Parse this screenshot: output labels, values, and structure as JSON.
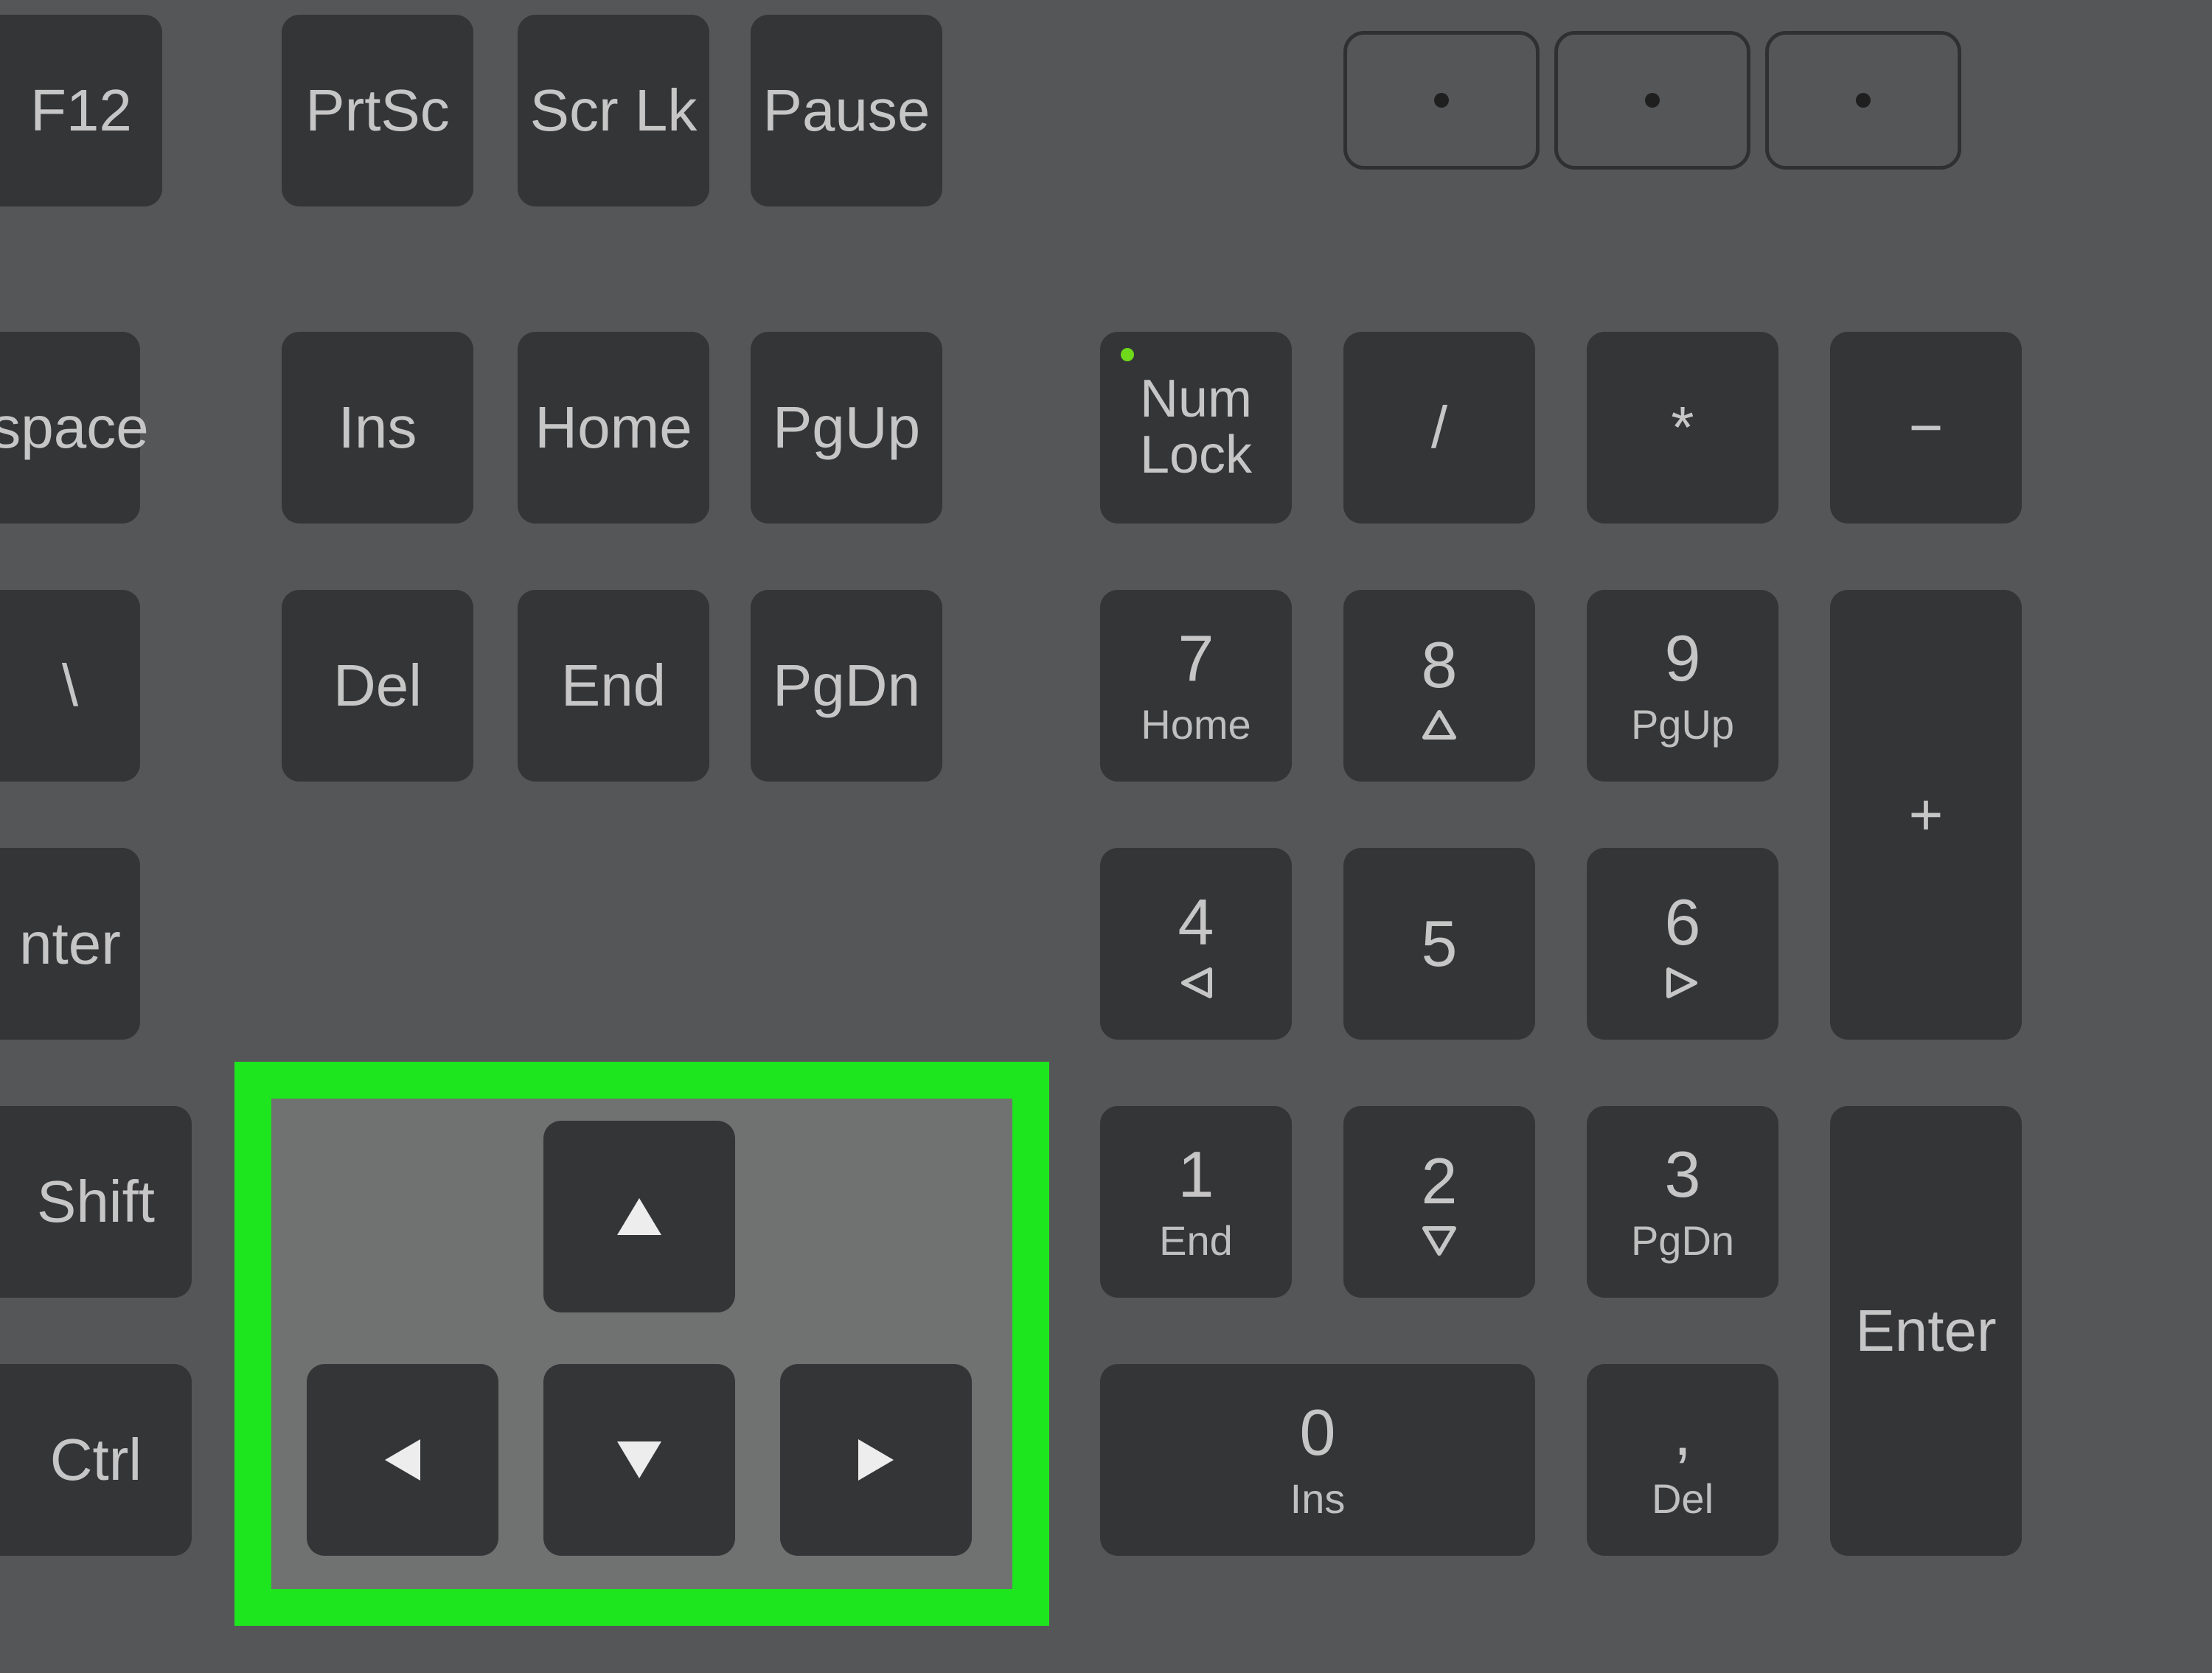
{
  "keys": {
    "f12": "F12",
    "prtsc": "PrtSc",
    "scrlk": "Scr Lk",
    "pause": "Pause",
    "space": "space",
    "ins": "Ins",
    "home": "Home",
    "pgup": "PgUp",
    "backslash": "\\",
    "del": "Del",
    "end": "End",
    "pgdn": "PgDn",
    "enter_side": "nter",
    "shift_side": "Shift",
    "ctrl_side": "Ctrl",
    "numlock_l1": "Num",
    "numlock_l2": "Lock",
    "div": "/",
    "mul": "*",
    "minus": "−",
    "plus": "+",
    "np7": "7",
    "np7s": "Home",
    "np8": "8",
    "np9": "9",
    "np9s": "PgUp",
    "np4": "4",
    "np5": "5",
    "np6": "6",
    "np1": "1",
    "np1s": "End",
    "np2": "2",
    "np3": "3",
    "np3s": "PgDn",
    "np0": "0",
    "np0s": "Ins",
    "npDot": ",",
    "npDots": "Del",
    "npEnter": "Enter"
  },
  "highlight": {
    "target": "arrow-keys-cluster",
    "color": "#1ee61e"
  }
}
